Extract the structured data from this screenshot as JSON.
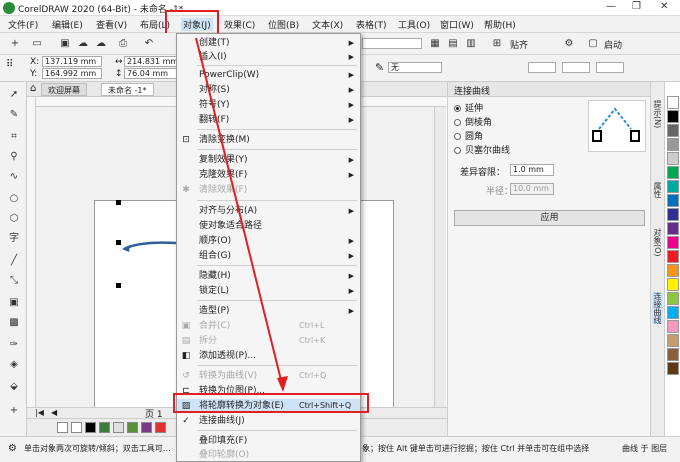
{
  "titlebar": {
    "title": "CorelDRAW 2020 (64-Bit) - 未命名 -1*",
    "min": "—",
    "max": "❐",
    "close": "✕"
  },
  "menubar": {
    "items": [
      "文件(F)",
      "编辑(E)",
      "查看(V)",
      "布局(L)",
      "对象(J)",
      "效果(C)",
      "位图(B)",
      "文本(X)",
      "表格(T)",
      "工具(O)",
      "窗口(W)",
      "帮助(H)"
    ]
  },
  "toolbar": {
    "paste_label": "贴齐",
    "launch_label": "启动"
  },
  "propbar": {
    "x_label": "X:",
    "x_value": "137.119 mm",
    "y_label": "Y:",
    "y_value": "164.992 mm",
    "w_value": "214.831 mm",
    "h_value": "76.04 mm",
    "outline_value": "无"
  },
  "tabs": {
    "welcome": "欢迎屏幕",
    "doc": "未命名 -1*"
  },
  "pagenav": {
    "label": "页 1"
  },
  "statusbar": {
    "left": "单击对象两次可旋转/倾斜；双击工具可…",
    "mid": "象；按住 Alt 键单击可进行挖掘；按住 Ctrl 并单击可在组中选择",
    "right": "曲线 于 图层"
  },
  "object_menu": {
    "items": [
      {
        "label": "创建(T)",
        "arrow": true
      },
      {
        "label": "插入(I)",
        "arrow": true
      },
      {
        "label": "PowerClip(W)",
        "arrow": true
      },
      {
        "label": "对称(S)",
        "arrow": true
      },
      {
        "label": "符号(Y)",
        "arrow": true
      },
      {
        "label": "翻转(F)",
        "arrow": true
      },
      {
        "label": "清除变换(M)"
      },
      {
        "label": "复制效果(Y)",
        "arrow": true
      },
      {
        "label": "克隆效果(F)",
        "arrow": true
      },
      {
        "label": "清除效果(F)",
        "disabled": true
      },
      {
        "label": "对齐与分布(A)",
        "arrow": true
      },
      {
        "label": "使对象适合路径"
      },
      {
        "label": "顺序(O)",
        "arrow": true
      },
      {
        "label": "组合(G)",
        "arrow": true
      },
      {
        "label": "隐藏(H)",
        "arrow": true
      },
      {
        "label": "锁定(L)",
        "arrow": true
      },
      {
        "label": "造型(P)",
        "arrow": true
      },
      {
        "label": "合并(C)",
        "shortcut": "Ctrl+L",
        "disabled": true
      },
      {
        "label": "拆分",
        "shortcut": "Ctrl+K",
        "disabled": true
      },
      {
        "label": "添加透视(P)..."
      },
      {
        "label": "转换为曲线(V)",
        "shortcut": "Ctrl+Q",
        "disabled": true
      },
      {
        "label": "转换为位图(P)..."
      },
      {
        "label": "将轮廓转换为对象(E)",
        "shortcut": "Ctrl+Shift+Q"
      },
      {
        "label": "连接曲线(J)"
      },
      {
        "label": "叠印填充(F)"
      },
      {
        "label": "叠印轮廓(O)",
        "disabled": true
      }
    ]
  },
  "docker": {
    "title": "连接曲线",
    "options": [
      "延伸",
      "倒棱角",
      "圆角",
      "贝塞尔曲线"
    ],
    "tolerance_label": "差异容限：",
    "tolerance_value": "1.0 mm",
    "radius_label": "半径：",
    "radius_value": "10.0 mm",
    "apply_label": "应用"
  },
  "vtabs": [
    "提示(N)",
    "属性",
    "对象(O)",
    "连接曲线"
  ],
  "colors": {
    "accent": "#e02020",
    "arrow": "#2a5c8f",
    "doc_arrow": "#2f5f9a"
  }
}
